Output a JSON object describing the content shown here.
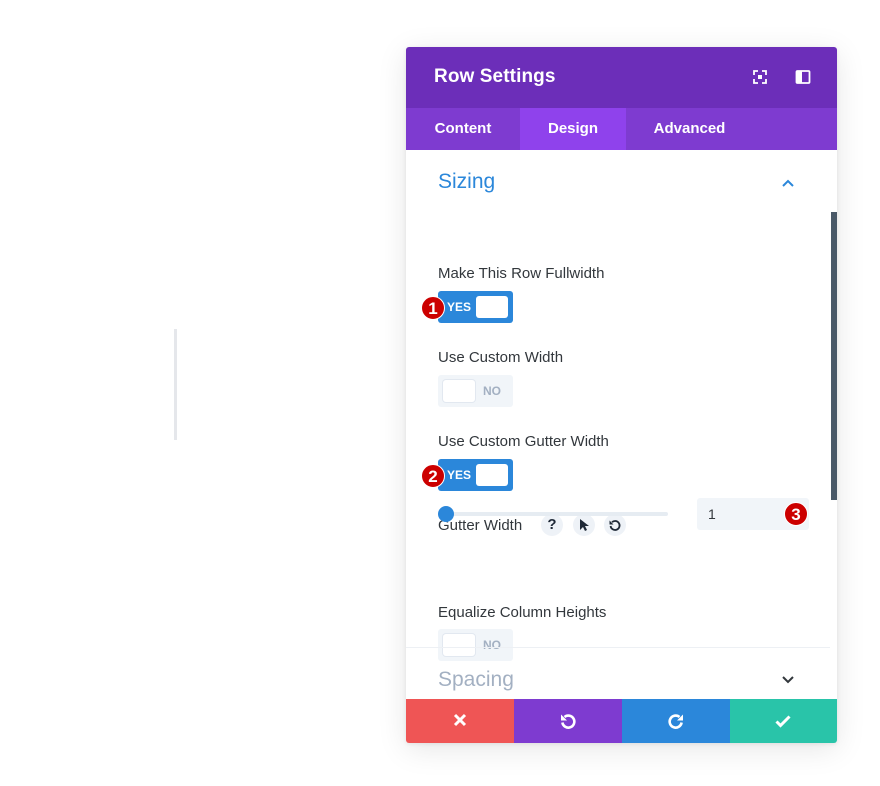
{
  "modal": {
    "title": "Row Settings",
    "header_icons": [
      "fullscreen-icon",
      "sidebar-toggle-icon"
    ]
  },
  "tabs": [
    {
      "label": "Content",
      "active": false
    },
    {
      "label": "Design",
      "active": true
    },
    {
      "label": "Advanced",
      "active": false
    }
  ],
  "sizing": {
    "title": "Sizing",
    "expanded": true,
    "fullwidth": {
      "label": "Make This Row Fullwidth",
      "state": "YES"
    },
    "custom_width": {
      "label": "Use Custom Width",
      "state": "NO"
    },
    "custom_gutter": {
      "label": "Use Custom Gutter Width",
      "state": "YES"
    },
    "gutter_width": {
      "label": "Gutter Width",
      "help": "?",
      "value": "1",
      "slider_fraction": 0
    },
    "equalize": {
      "label": "Equalize Column Heights",
      "state": "NO"
    }
  },
  "spacing": {
    "title": "Spacing",
    "expanded": false
  },
  "annotations": [
    "1",
    "2",
    "3"
  ],
  "colors": {
    "header": "#6c2eb9",
    "tabs": "#7e3bd0",
    "tab_active": "#8f42ec",
    "accent": "#2b87da",
    "cancel": "#ef5555",
    "undo": "#7e3bd0",
    "redo": "#2b87da",
    "save": "#29c4a9",
    "badge": "#cc0000"
  },
  "footer": [
    "close-icon",
    "undo-icon",
    "redo-icon",
    "check-icon"
  ]
}
